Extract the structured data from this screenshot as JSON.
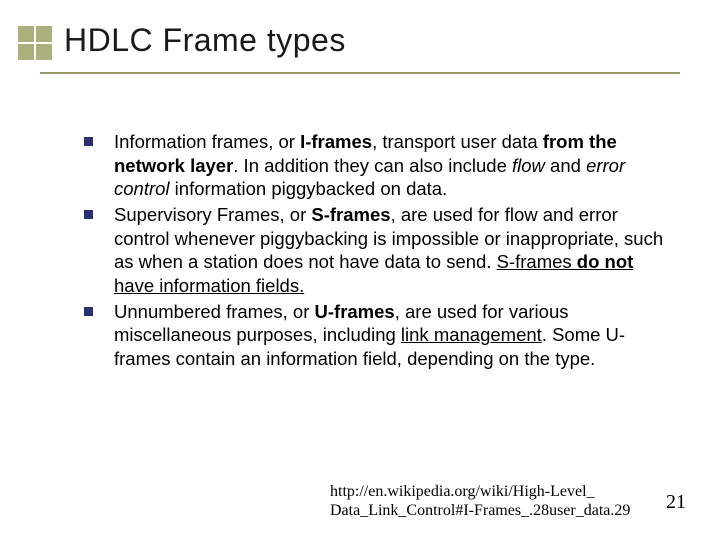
{
  "title": "HDLC Frame types",
  "bullets": [
    {
      "pre": "Information frames, or ",
      "bold1": "I-frames",
      "mid1": ", transport user data ",
      "bold2": "from the network layer",
      "mid2": ". In addition they can also include ",
      "ital1": "flow",
      "mid3": " and ",
      "ital2": "error control",
      "tail": " information piggybacked on data."
    },
    {
      "pre": "Supervisory Frames, or ",
      "bold1": "S-frames",
      "mid1": ", are used for flow and error control whenever piggybacking is impossible or inappropriate, such as when a station does not have data to send. ",
      "u1": "S-frames ",
      "bold2": "do not",
      "u2": " have information fields.",
      "tail": ""
    },
    {
      "pre": "Unnumbered frames, or ",
      "bold1": "U-frames",
      "mid1": ", are used for various miscellaneous purposes, including ",
      "u1": "link management",
      "tail": ". Some U-frames contain an information field, depending on the type."
    }
  ],
  "footer": {
    "line1": "http://en.wikipedia.org/wiki/High-Level_",
    "line2": "Data_Link_Control#I-Frames_.28user_data.29"
  },
  "pageNumber": "21"
}
